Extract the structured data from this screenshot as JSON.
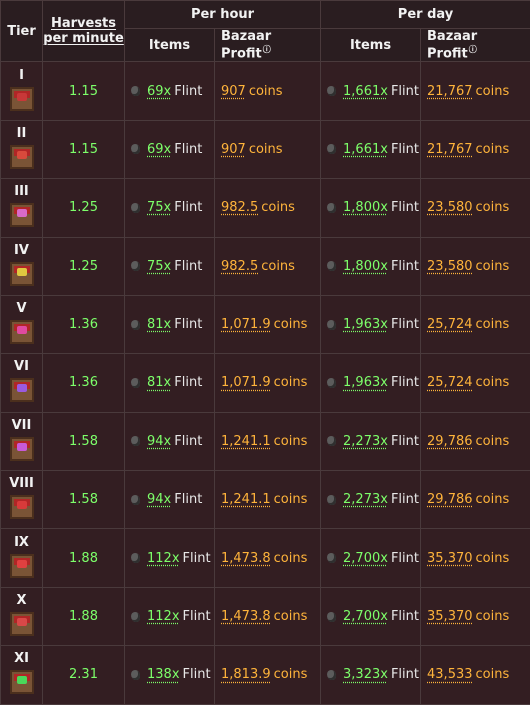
{
  "headers": {
    "tier": "Tier",
    "harvests_line1": "Harvests",
    "harvests_line2": "per minute",
    "per_hour": "Per hour",
    "per_day": "Per day",
    "items": "Items",
    "bazaar_profit": "Bazaar Profit",
    "info_marker": "ⓘ"
  },
  "item_name": "Flint",
  "coin_unit": "coins",
  "rows": [
    {
      "tier": "I",
      "rate": "1.15",
      "hour_qty": "69x",
      "hour_coins": "907",
      "day_qty": "1,661x",
      "day_coins": "21,767",
      "gem": "#c83838"
    },
    {
      "tier": "II",
      "rate": "1.15",
      "hour_qty": "69x",
      "hour_coins": "907",
      "day_qty": "1,661x",
      "day_coins": "21,767",
      "gem": "#d84a3c"
    },
    {
      "tier": "III",
      "rate": "1.25",
      "hour_qty": "75x",
      "hour_coins": "982.5",
      "day_qty": "1,800x",
      "day_coins": "23,580",
      "gem": "#d86ac8"
    },
    {
      "tier": "IV",
      "rate": "1.25",
      "hour_qty": "75x",
      "hour_coins": "982.5",
      "day_qty": "1,800x",
      "day_coins": "23,580",
      "gem": "#e0c840"
    },
    {
      "tier": "V",
      "rate": "1.36",
      "hour_qty": "81x",
      "hour_coins": "1,071.9",
      "day_qty": "1,963x",
      "day_coins": "25,724",
      "gem": "#e04aa0"
    },
    {
      "tier": "VI",
      "rate": "1.36",
      "hour_qty": "81x",
      "hour_coins": "1,071.9",
      "day_qty": "1,963x",
      "day_coins": "25,724",
      "gem": "#9a5ae0"
    },
    {
      "tier": "VII",
      "rate": "1.58",
      "hour_qty": "94x",
      "hour_coins": "1,241.1",
      "day_qty": "2,273x",
      "day_coins": "29,786",
      "gem": "#c85ad8"
    },
    {
      "tier": "VIII",
      "rate": "1.58",
      "hour_qty": "94x",
      "hour_coins": "1,241.1",
      "day_qty": "2,273x",
      "day_coins": "29,786",
      "gem": "#d83a3a"
    },
    {
      "tier": "IX",
      "rate": "1.88",
      "hour_qty": "112x",
      "hour_coins": "1,473.8",
      "day_qty": "2,700x",
      "day_coins": "35,370",
      "gem": "#e04040"
    },
    {
      "tier": "X",
      "rate": "1.88",
      "hour_qty": "112x",
      "hour_coins": "1,473.8",
      "day_qty": "2,700x",
      "day_coins": "35,370",
      "gem": "#d84848"
    },
    {
      "tier": "XI",
      "rate": "2.31",
      "hour_qty": "138x",
      "hour_coins": "1,813.9",
      "day_qty": "3,323x",
      "day_coins": "43,533",
      "gem": "#4ad85a"
    }
  ]
}
